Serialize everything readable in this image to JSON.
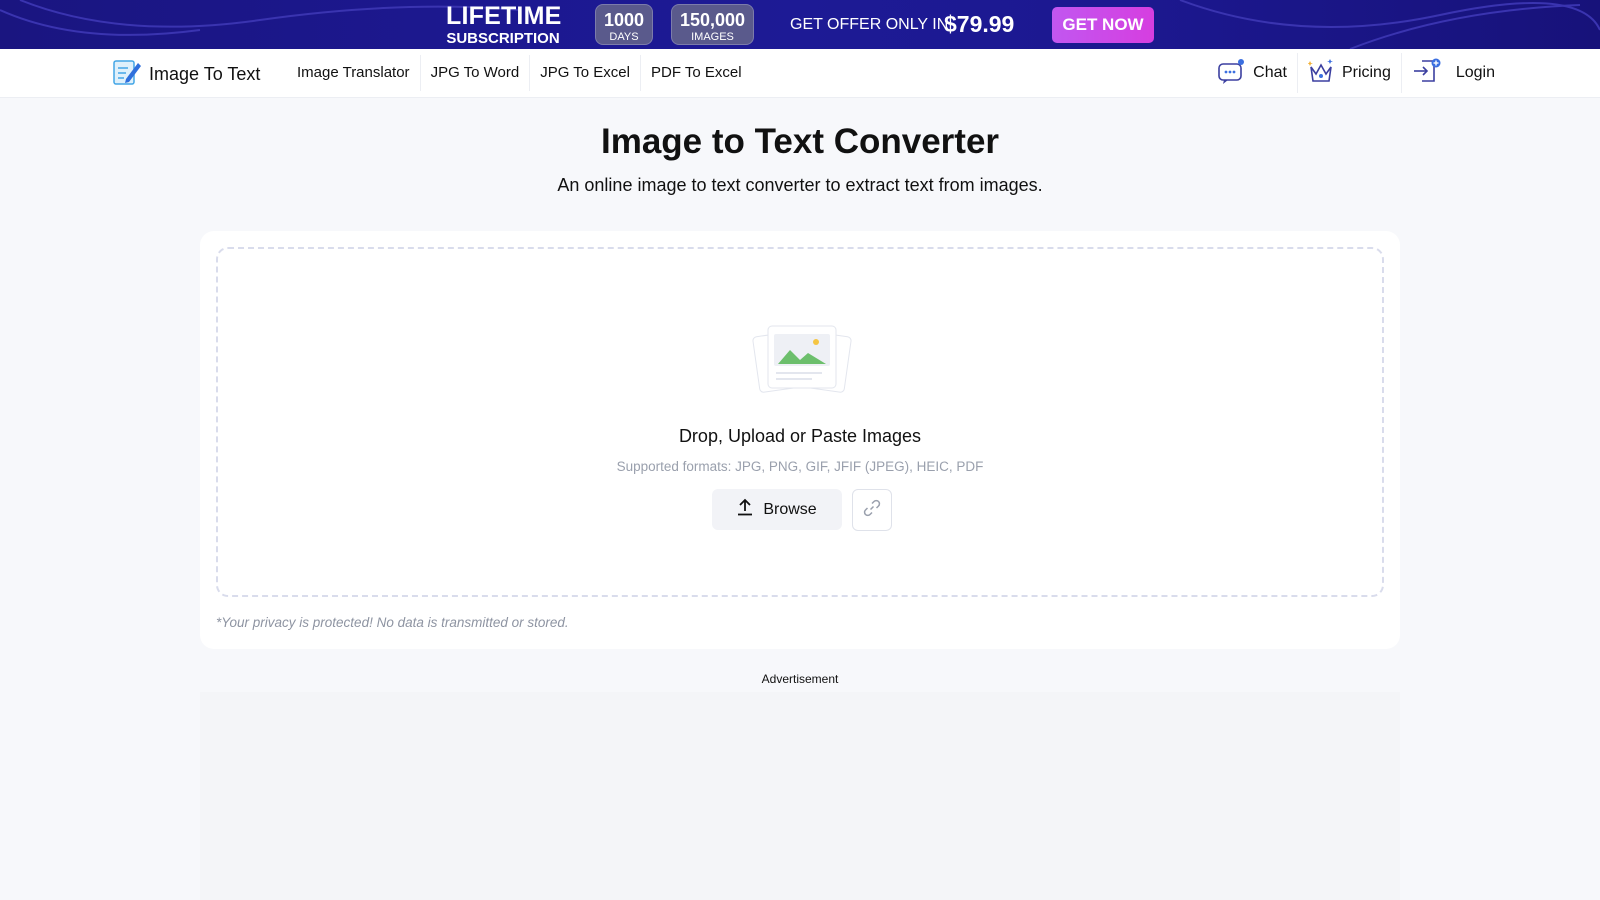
{
  "promo": {
    "title_big": "LIFETIME",
    "title_small": "SUBSCRIPTION",
    "days_value": "1000",
    "days_unit": "DAYS",
    "images_value": "150,000",
    "images_unit": "IMAGES",
    "offer_text": "GET OFFER ONLY IN",
    "price": "$79.99",
    "cta_label": "GET NOW"
  },
  "nav": {
    "logo_text": "Image To Text",
    "links": [
      "Image Translator",
      "JPG To Word",
      "JPG To Excel",
      "PDF To Excel"
    ],
    "chat_label": "Chat",
    "pricing_label": "Pricing",
    "login_label": "Login"
  },
  "hero": {
    "title": "Image to Text Converter",
    "subtitle": "An online image to text converter to extract text from images."
  },
  "upload": {
    "title": "Drop, Upload or Paste Images",
    "formats": "Supported formats: JPG, PNG, GIF, JFIF (JPEG), HEIC, PDF",
    "browse_label": "Browse",
    "privacy_note": "*Your privacy is protected! No data is transmitted or stored."
  },
  "ad": {
    "label": "Advertisement"
  },
  "colors": {
    "banner": "#1c1890",
    "cta": "#c157f0",
    "accent": "#3b6fe0"
  }
}
